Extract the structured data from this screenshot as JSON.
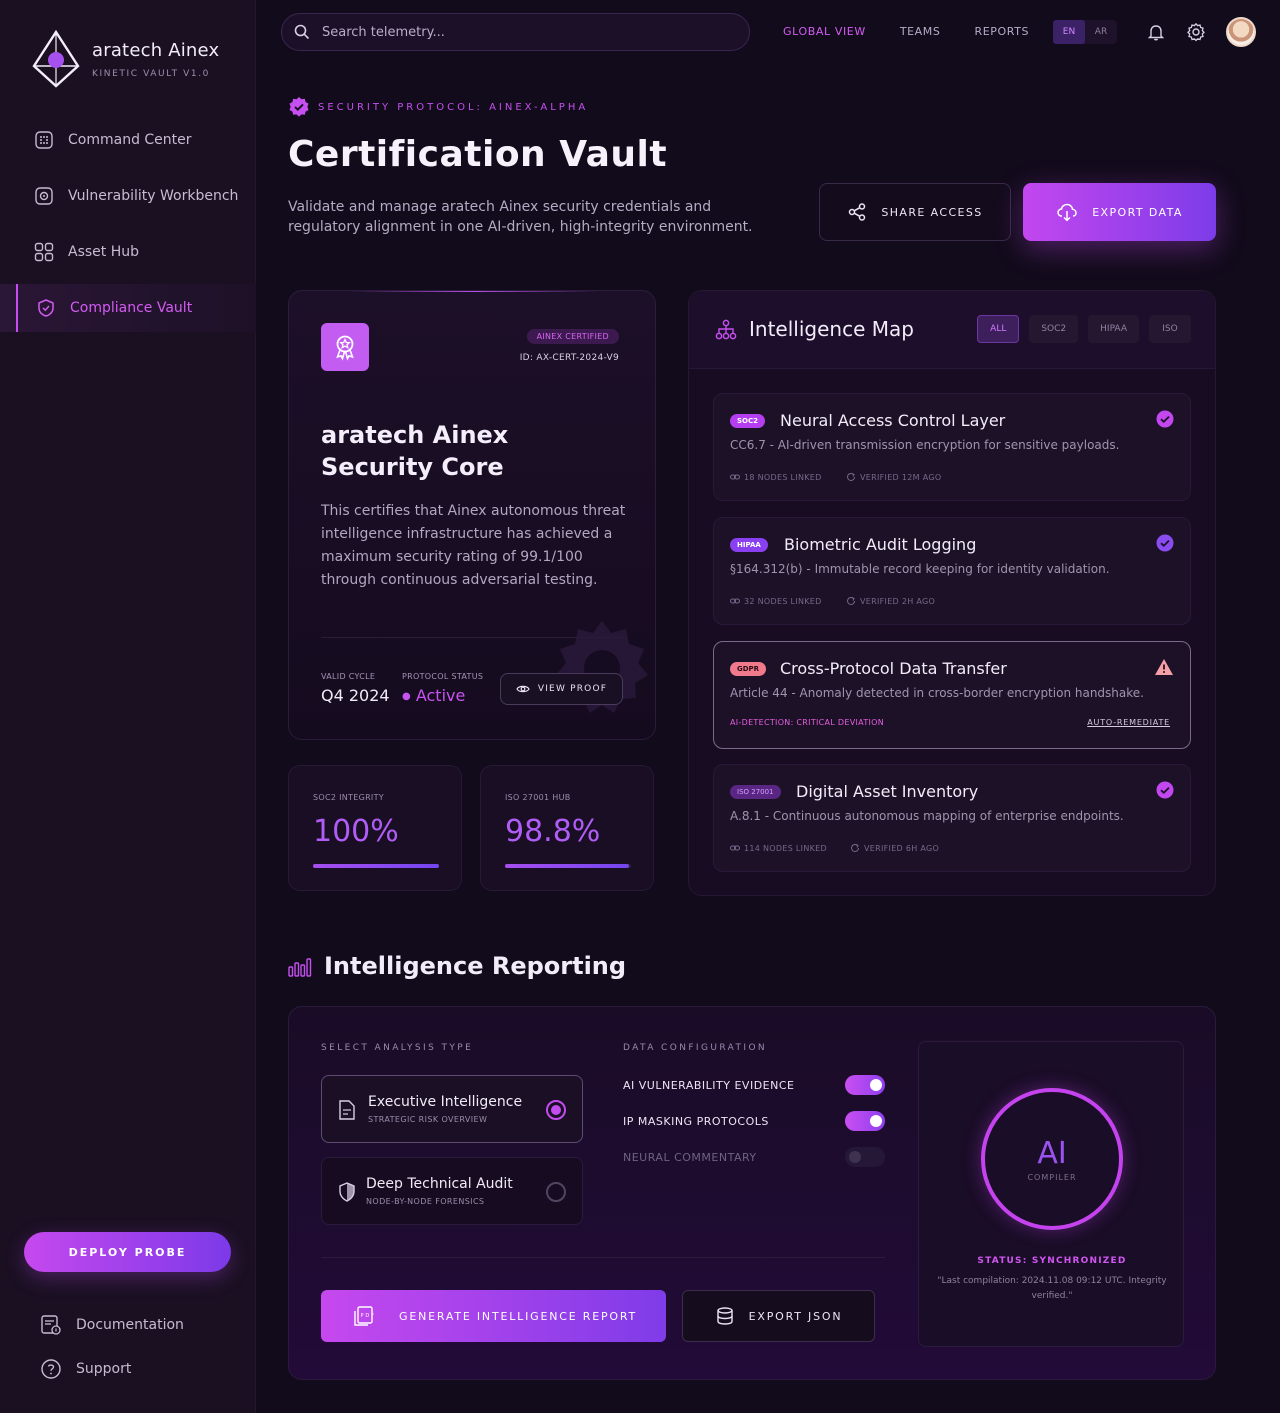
{
  "brand": {
    "name": "aratech Ainex",
    "subtitle": "KINETIC VAULT V1.0"
  },
  "sidebar": {
    "items": [
      {
        "label": "Command Center",
        "icon": "command-center-icon",
        "active": false
      },
      {
        "label": "Vulnerability Workbench",
        "icon": "vulnerability-icon",
        "active": false
      },
      {
        "label": "Asset Hub",
        "icon": "grid-icon",
        "active": false
      },
      {
        "label": "Compliance Vault",
        "icon": "shield-check-icon",
        "active": true
      }
    ],
    "deploy_label": "DEPLOY PROBE",
    "footer": [
      {
        "label": "Documentation",
        "icon": "documentation-icon"
      },
      {
        "label": "Support",
        "icon": "help-icon"
      }
    ]
  },
  "topbar": {
    "search_placeholder": "Search telemetry...",
    "nav": [
      "GLOBAL VIEW",
      "TEAMS",
      "REPORTS"
    ],
    "active_nav": "GLOBAL VIEW",
    "languages": [
      "EN",
      "AR"
    ],
    "active_language": "EN"
  },
  "header": {
    "protocol": "SECURITY PROTOCOL: AINEX-ALPHA",
    "title": "Certification Vault",
    "description": "Validate and manage aratech Ainex security credentials and regulatory alignment in one AI-driven, high-integrity environment.",
    "share_label": "SHARE ACCESS",
    "export_label": "EXPORT DATA"
  },
  "certificate": {
    "badge": "AINEX CERTIFIED",
    "id": "ID: AX-CERT-2024-V9",
    "title": "aratech Ainex Security Core",
    "body": "This certifies that Ainex autonomous threat intelligence infrastructure has achieved a maximum security rating of 99.1/100 through continuous adversarial testing.",
    "valid_cycle_label": "VALID CYCLE",
    "valid_cycle": "Q4 2024",
    "status_label": "PROTOCOL STATUS",
    "status": "Active",
    "view_proof_label": "VIEW PROOF"
  },
  "metrics": [
    {
      "label": "SOC2 INTEGRITY",
      "value": "100%",
      "fill": 1.0
    },
    {
      "label": "ISO 27001 HUB",
      "value": "98.8%",
      "fill": 0.988
    }
  ],
  "map": {
    "title": "Intelligence Map",
    "filters": [
      "ALL",
      "SOC2",
      "HIPAA",
      "ISO"
    ],
    "active_filter": "ALL",
    "items": [
      {
        "tag": "SOC2",
        "title": "Neural Access Control Layer",
        "desc": "CC6.7 - AI-driven transmission encryption for sensitive payloads.",
        "nodes": "18 NODES LINKED",
        "verified": "VERIFIED 12M AGO",
        "status": "ok"
      },
      {
        "tag": "HIPAA",
        "title": "Biometric Audit Logging",
        "desc": "§164.312(b) - Immutable record keeping for identity validation.",
        "nodes": "32 NODES LINKED",
        "verified": "VERIFIED 2H AGO",
        "status": "ok"
      },
      {
        "tag": "GDPR",
        "title": "Cross-Protocol Data Transfer",
        "desc": "Article 44 - Anomaly detected in cross-border encryption handshake.",
        "alert": "AI-DETECTION: CRITICAL DEVIATION",
        "action": "AUTO-REMEDIATE",
        "status": "warning"
      },
      {
        "tag": "ISO 27001",
        "title": "Digital Asset Inventory",
        "desc": "A.8.1 - Continuous autonomous mapping of enterprise endpoints.",
        "nodes": "114 NODES LINKED",
        "verified": "VERIFIED 6H AGO",
        "status": "ok"
      }
    ],
    "tag_colors": {
      "SOC2": "#b43ef0",
      "HIPAA": "#8a3ff0",
      "GDPR": "#f07a8c",
      "ISO 27001": "#7a2fa8"
    }
  },
  "reporting": {
    "title": "Intelligence Reporting",
    "analysis_label": "SELECT ANALYSIS TYPE",
    "options": [
      {
        "title": "Executive Intelligence",
        "sub": "STRATEGIC RISK OVERVIEW",
        "selected": true
      },
      {
        "title": "Deep Technical Audit",
        "sub": "NODE-BY-NODE FORENSICS",
        "selected": false
      }
    ],
    "config_label": "DATA CONFIGURATION",
    "toggles": [
      {
        "label": "AI VULNERABILITY EVIDENCE",
        "on": true
      },
      {
        "label": "IP MASKING PROTOCOLS",
        "on": true
      },
      {
        "label": "NEURAL COMMENTARY",
        "on": false
      }
    ],
    "generate_label": "GENERATE INTELLIGENCE REPORT",
    "json_label": "EXPORT JSON",
    "compiler": {
      "ring_text": "AI",
      "ring_sub": "COMPILER",
      "status": "STATUS: SYNCHRONIZED",
      "note": "\"Last compilation: 2024.11.08 09:12 UTC. Integrity verified.\""
    }
  },
  "colors": {
    "accent": "#c64ff0",
    "background": "#120b1b",
    "sidebar": "#1a1022"
  }
}
